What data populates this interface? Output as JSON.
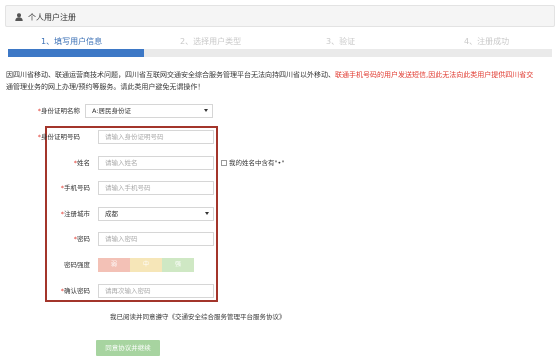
{
  "header": {
    "title": "个人用户注册",
    "icon": "user-icon"
  },
  "steps": [
    {
      "label": "1、填写用户信息",
      "active": true
    },
    {
      "label": "2、选择用户类型",
      "active": false
    },
    {
      "label": "3、验证",
      "active": false
    },
    {
      "label": "4、注册成功",
      "active": false
    }
  ],
  "progress": {
    "fraction": 0.25,
    "color": "#3d78c6"
  },
  "notice": {
    "part1": "因四川省移动、联通运营商技术问题，四川省互联网交通安全综合服务管理平台无法向持四川省以外移动、",
    "part2": "联通手机号码的用户发送短信,因此无法向此类用户提供四川省交",
    "part3": "通管理业务的网上办理/预约等服务。请此类用户避免无谓操作！"
  },
  "form": {
    "id_type": {
      "label": "身份证明名称",
      "value": "A:居民身份证"
    },
    "id_number": {
      "label": "身份证明号码",
      "placeholder": "请输入身份证明号码"
    },
    "name": {
      "label": "姓名",
      "placeholder": "请输入姓名",
      "side_note": "我的姓名中含有\"•\""
    },
    "phone": {
      "label": "手机号码",
      "placeholder": "请输入手机号码"
    },
    "city": {
      "label": "注册城市",
      "value": "成都"
    },
    "password": {
      "label": "密码",
      "placeholder": "请输入密码"
    },
    "strength": {
      "label": "密码强度",
      "segments": [
        "弱",
        "中",
        "强"
      ]
    },
    "confirm": {
      "label": "确认密码",
      "placeholder": "请再次输入密码"
    }
  },
  "agreement": {
    "text": "我已阅读并同意遵守《交通安全综合服务管理平台服务协议》"
  },
  "submit": {
    "label": "同意协议并继续"
  },
  "colors": {
    "accent": "#3d78c6",
    "required": "#e0382e",
    "highlight_box": "#a3352b",
    "submit_bg": "#a7d4a0"
  }
}
